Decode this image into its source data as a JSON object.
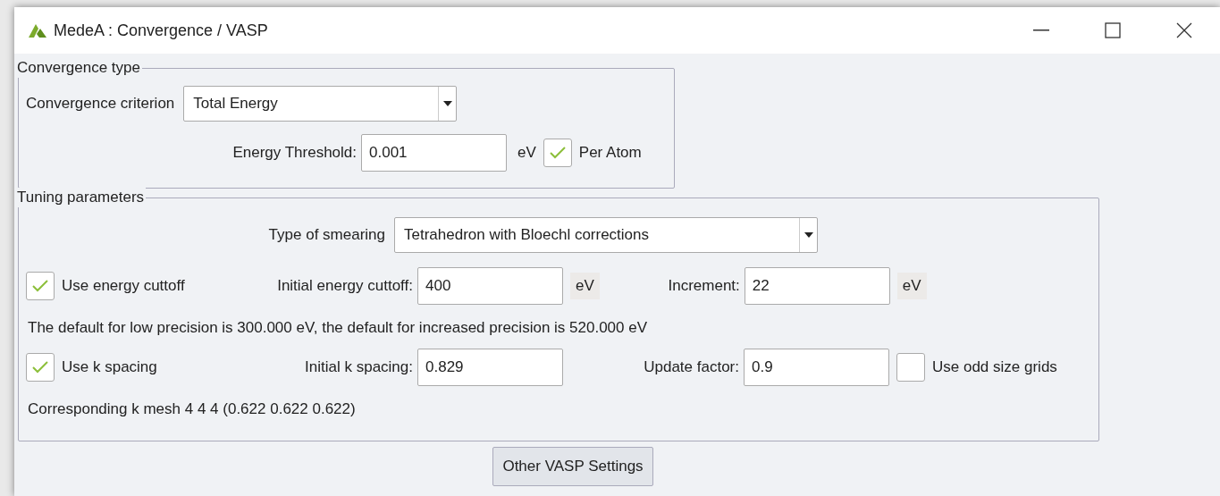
{
  "window": {
    "title": "MedeA : Convergence / VASP"
  },
  "convergence_type": {
    "legend": "Convergence type",
    "criterion": {
      "label": "Convergence criterion",
      "value": "Total Energy"
    },
    "threshold": {
      "label": "Energy Threshold:",
      "value": "0.001",
      "unit": "eV"
    },
    "per_atom": {
      "label": "Per Atom",
      "checked": true
    }
  },
  "tuning": {
    "legend": "Tuning parameters",
    "smearing": {
      "label": "Type of smearing",
      "value": "Tetrahedron with Bloechl corrections"
    },
    "energy_cutoff": {
      "label": "Use energy cuttoff",
      "checked": true,
      "initial_label": "Initial energy cuttoff:",
      "initial_value": "400",
      "initial_unit": "eV",
      "increment_label": "Increment:",
      "increment_value": "22",
      "increment_unit": "eV"
    },
    "precision_note": "The default for low precision is 300.000 eV, the default for increased precision is 520.000 eV",
    "k_spacing": {
      "label": "Use k spacing",
      "checked": true,
      "initial_label": "Initial k spacing:",
      "initial_value": "0.829",
      "factor_label": "Update factor:",
      "factor_value": "0.9"
    },
    "odd_grids": {
      "label": "Use odd size grids",
      "checked": false
    },
    "mesh_note": "Corresponding k mesh 4 4 4 (0.622 0.622 0.622)"
  },
  "button": "Other VASP Settings"
}
